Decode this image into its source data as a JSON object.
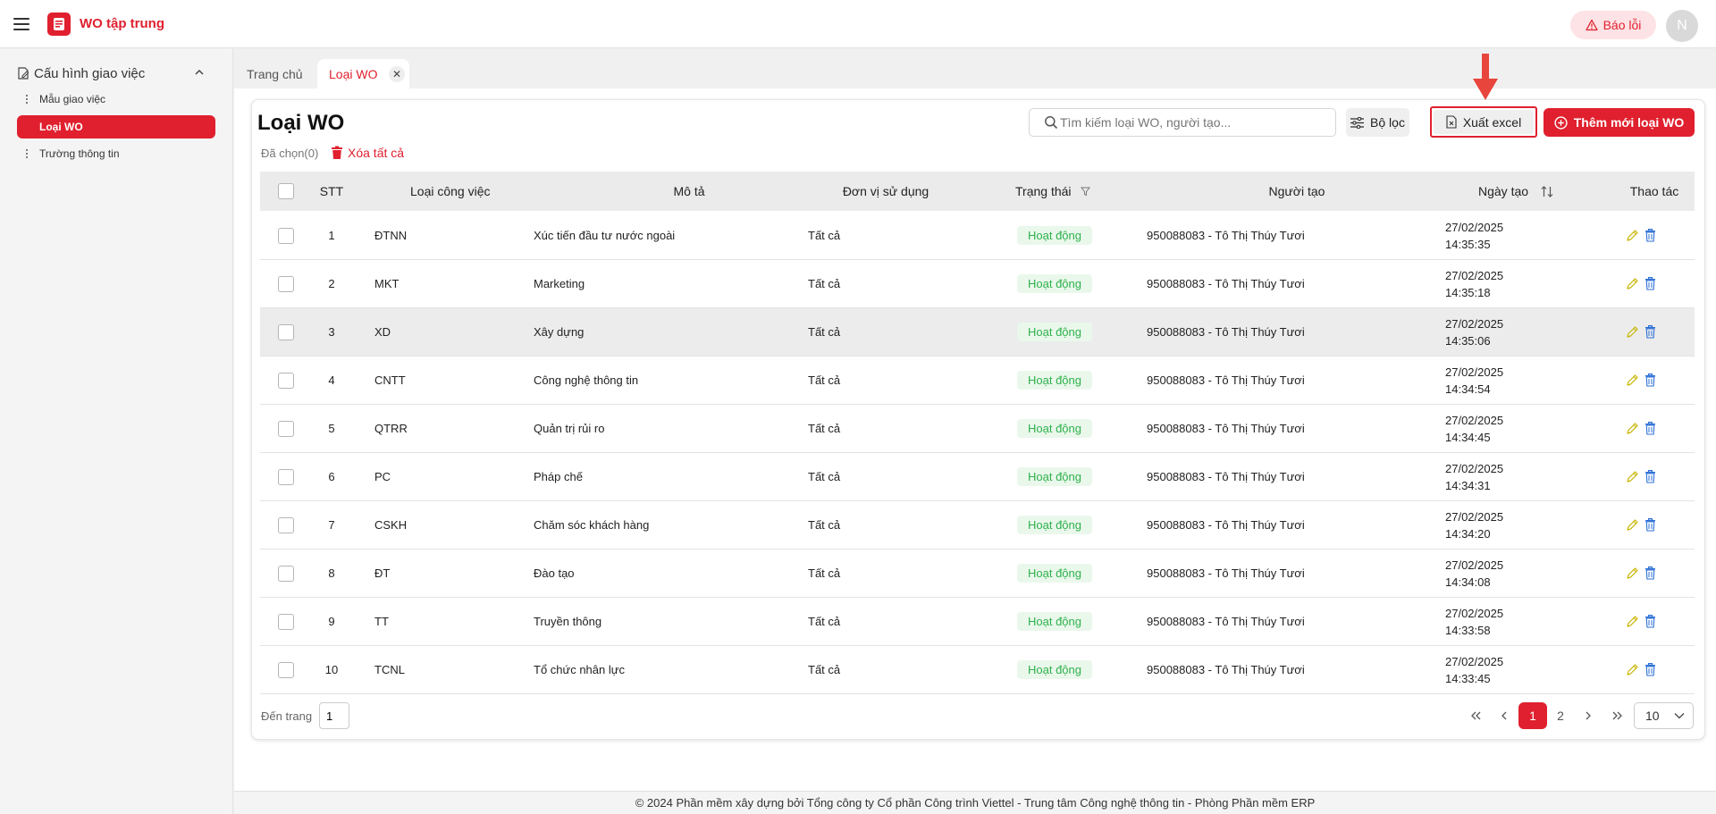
{
  "header": {
    "app_title": "WO tập trung",
    "report_label": "Báo lỗi",
    "avatar_initial": "N"
  },
  "sidebar": {
    "group_label": "Cấu hình giao việc",
    "items": [
      {
        "label": "Mẫu giao việc",
        "active": false
      },
      {
        "label": "Loại WO",
        "active": true
      },
      {
        "label": "Trường thông tin",
        "active": false
      }
    ]
  },
  "tabs": [
    {
      "label": "Trang chủ"
    },
    {
      "label": "Loại WO"
    }
  ],
  "page": {
    "title": "Loại WO",
    "selected_text": "Đã chọn(0)",
    "delete_all_label": "Xóa tất cả",
    "search_placeholder": "Tìm kiếm loại WO, người tạo...",
    "filter_label": "Bộ lọc",
    "excel_label": "Xuất excel",
    "add_label": "Thêm mới loại WO"
  },
  "table": {
    "headers": {
      "stt": "STT",
      "type": "Loại công việc",
      "desc": "Mô tả",
      "unit": "Đơn vị sử dụng",
      "status": "Trạng thái",
      "creator": "Người tạo",
      "created": "Ngày tạo",
      "actions": "Thao tác"
    },
    "rows": [
      {
        "stt": "1",
        "type": "ĐTNN",
        "desc": "Xúc tiến đầu tư nước ngoài",
        "unit": "Tất cả",
        "status": "Hoạt động",
        "creator": "950088083 - Tô Thị Thúy Tươi",
        "date": "27/02/2025",
        "time": "14:35:35"
      },
      {
        "stt": "2",
        "type": "MKT",
        "desc": "Marketing",
        "unit": "Tất cả",
        "status": "Hoạt động",
        "creator": "950088083 - Tô Thị Thúy Tươi",
        "date": "27/02/2025",
        "time": "14:35:18"
      },
      {
        "stt": "3",
        "type": "XD",
        "desc": "Xây dựng",
        "unit": "Tất cả",
        "status": "Hoạt động",
        "creator": "950088083 - Tô Thị Thúy Tươi",
        "date": "27/02/2025",
        "time": "14:35:06"
      },
      {
        "stt": "4",
        "type": "CNTT",
        "desc": "Công nghệ thông tin",
        "unit": "Tất cả",
        "status": "Hoạt động",
        "creator": "950088083 - Tô Thị Thúy Tươi",
        "date": "27/02/2025",
        "time": "14:34:54"
      },
      {
        "stt": "5",
        "type": "QTRR",
        "desc": "Quản trị rủi ro",
        "unit": "Tất cả",
        "status": "Hoạt động",
        "creator": "950088083 - Tô Thị Thúy Tươi",
        "date": "27/02/2025",
        "time": "14:34:45"
      },
      {
        "stt": "6",
        "type": "PC",
        "desc": "Pháp chế",
        "unit": "Tất cả",
        "status": "Hoạt động",
        "creator": "950088083 - Tô Thị Thúy Tươi",
        "date": "27/02/2025",
        "time": "14:34:31"
      },
      {
        "stt": "7",
        "type": "CSKH",
        "desc": "Chăm sóc khách hàng",
        "unit": "Tất cả",
        "status": "Hoạt động",
        "creator": "950088083 - Tô Thị Thúy Tươi",
        "date": "27/02/2025",
        "time": "14:34:20"
      },
      {
        "stt": "8",
        "type": "ĐT",
        "desc": "Đào tạo",
        "unit": "Tất cả",
        "status": "Hoạt động",
        "creator": "950088083 - Tô Thị Thúy Tươi",
        "date": "27/02/2025",
        "time": "14:34:08"
      },
      {
        "stt": "9",
        "type": "TT",
        "desc": "Truyền thông",
        "unit": "Tất cả",
        "status": "Hoạt động",
        "creator": "950088083 - Tô Thị Thúy Tươi",
        "date": "27/02/2025",
        "time": "14:33:58"
      },
      {
        "stt": "10",
        "type": "TCNL",
        "desc": "Tổ chức nhân lực",
        "unit": "Tất cả",
        "status": "Hoạt động",
        "creator": "950088083 - Tô Thị Thúy Tươi",
        "date": "27/02/2025",
        "time": "14:33:45"
      }
    ]
  },
  "pagination": {
    "goto_label": "Đến trang",
    "goto_value": "1",
    "pages": [
      "1",
      "2"
    ],
    "current_page": "1",
    "page_size": "10"
  },
  "colors": {
    "brand": "#e0202e",
    "status_green": "#2fb14c",
    "status_bg": "#eaf8ec"
  },
  "icons": {
    "menu": "hamburger-icon",
    "warning": "warning-icon",
    "search": "search-icon",
    "filter": "sliders-icon",
    "excel": "file-excel-icon",
    "add": "plus-circle-icon",
    "edit": "pencil-icon",
    "delete": "trash-icon"
  },
  "footer": {
    "text": "© 2024 Phần mềm xây dựng bởi Tổng công ty Cổ phần Công trình Viettel - Trung tâm Công nghệ thông tin - Phòng Phần mềm ERP"
  }
}
